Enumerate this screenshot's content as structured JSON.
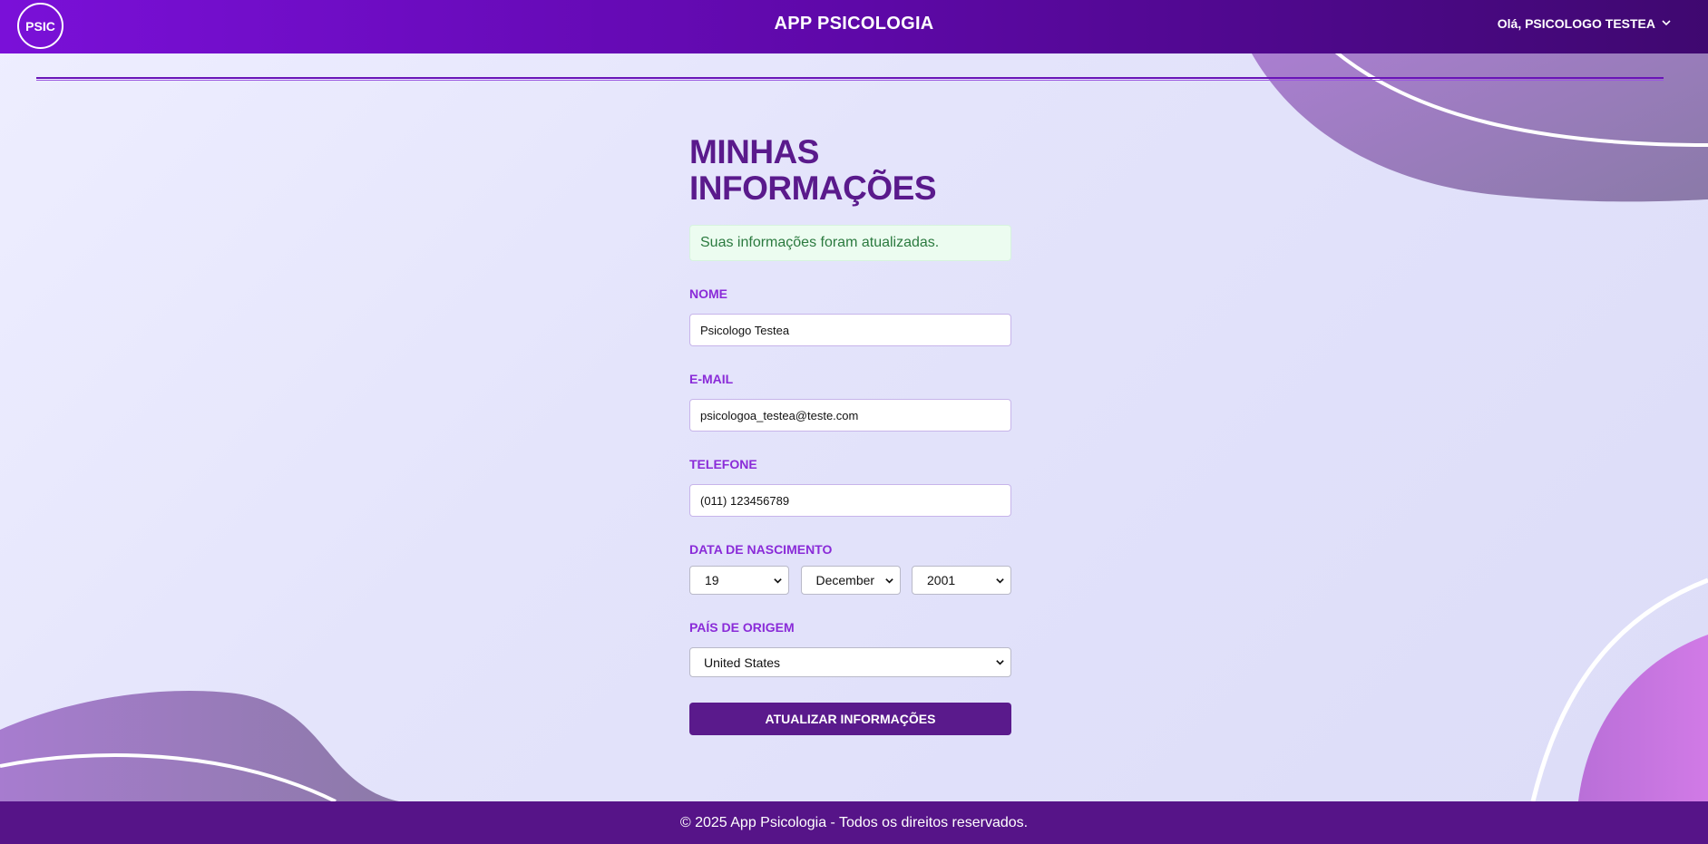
{
  "header": {
    "logo": "PSIC",
    "title": "APP PSICOLOGIA",
    "user_greeting": "Olá, PSICOLOGO TESTEA",
    "user_menu_icon": "chevron-down-icon"
  },
  "form": {
    "title_line1": "MINHAS",
    "title_line2": "INFORMAÇÕES",
    "success_message": "Suas informações foram atualizadas.",
    "name_label": "NOME",
    "name_value": "Psicologo Testea",
    "email_label": "E-MAIL",
    "email_value": "psicologoa_testea@teste.com",
    "phone_label": "TELEFONE",
    "phone_value": "(011) 123456789",
    "birth_label": "DATA DE NASCIMENTO",
    "birth_day": "19",
    "birth_month": "December",
    "birth_year": "2001",
    "country_label": "PAÍS DE ORIGEM",
    "country_value": "United States",
    "submit_label": "ATUALIZAR INFORMAÇÕES"
  },
  "footer": {
    "text": "© 2025 App Psicologia - Todos os direitos reservados."
  },
  "colors": {
    "primary": "#5a1a8c",
    "accent": "#8a2bd8",
    "success_bg": "#ecfcf0",
    "success_text": "#2b7a3f"
  }
}
